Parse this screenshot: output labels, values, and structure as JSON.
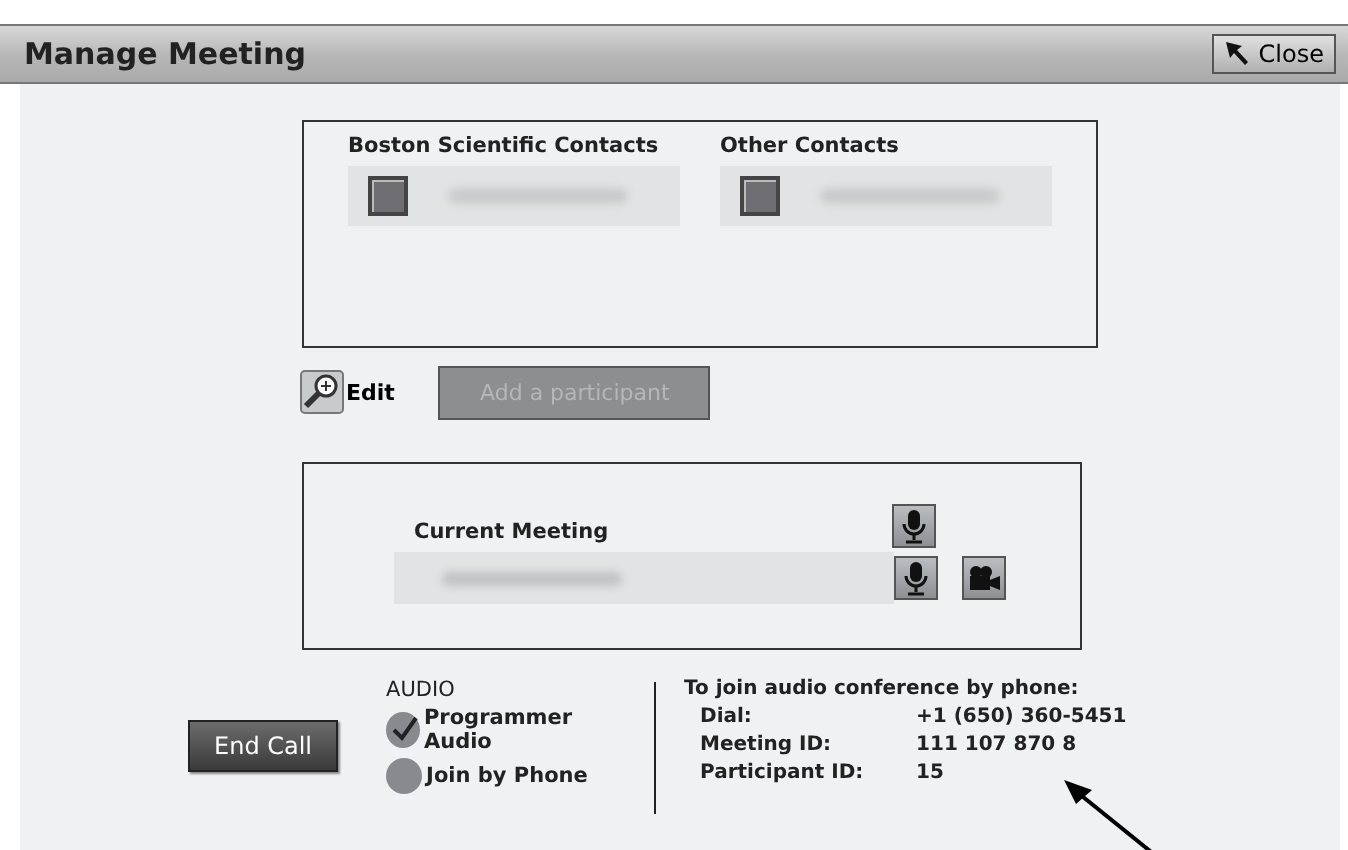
{
  "window": {
    "title": "Manage Meeting",
    "close_label": "Close"
  },
  "contacts": {
    "groups": [
      {
        "title": "Boston Scientific Contacts",
        "entries": [
          {
            "checked": false
          }
        ]
      },
      {
        "title": "Other Contacts",
        "entries": [
          {
            "checked": false
          }
        ]
      }
    ]
  },
  "edit_label": "Edit",
  "add_participant": {
    "label": "Add a participant",
    "disabled": true
  },
  "current_meeting": {
    "title": "Current Meeting",
    "host_muted": false,
    "participants": [
      {
        "muted": false,
        "video": true
      }
    ]
  },
  "end_call": "End Call",
  "audio": {
    "title": "AUDIO",
    "options": [
      {
        "label": "Programmer Audio",
        "selected": true
      },
      {
        "label": "Join by Phone",
        "selected": false
      }
    ]
  },
  "phone": {
    "heading": "To join audio conference by phone:",
    "rows": [
      {
        "label": "Dial:",
        "value": "+1 (650) 360-5451"
      },
      {
        "label": "Meeting ID:",
        "value": "111 107 870 8"
      },
      {
        "label": "Participant ID:",
        "value": "15"
      }
    ]
  }
}
